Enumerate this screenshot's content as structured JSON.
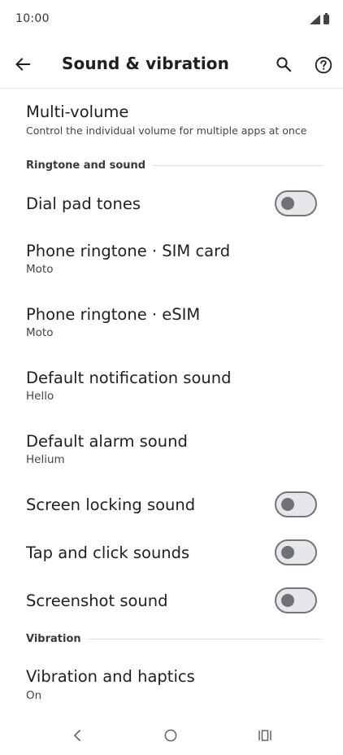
{
  "status_bar": {
    "time": "10:00",
    "icons": [
      "cell-signal-icon",
      "battery-icon"
    ]
  },
  "app_bar": {
    "title": "Sound & vibration",
    "back_icon": "arrow-back-icon",
    "search_icon": "search-icon",
    "help_icon": "help-circle-icon"
  },
  "settings": {
    "multi_volume": {
      "title": "Multi-volume",
      "summary": "Control the individual volume for multiple apps at once"
    },
    "category_ringtone": "Ringtone and sound",
    "dial_pad_tones": {
      "title": "Dial pad tones",
      "enabled": false
    },
    "ringtone_sim": {
      "title": "Phone ringtone · SIM card",
      "summary": "Moto"
    },
    "ringtone_esim": {
      "title": "Phone ringtone · eSIM",
      "summary": "Moto"
    },
    "notification_sound": {
      "title": "Default notification sound",
      "summary": "Hello"
    },
    "alarm_sound": {
      "title": "Default alarm sound",
      "summary": "Helium"
    },
    "screen_locking_sound": {
      "title": "Screen locking sound",
      "enabled": false
    },
    "tap_click_sounds": {
      "title": "Tap and click sounds",
      "enabled": false
    },
    "screenshot_sound": {
      "title": "Screenshot sound",
      "enabled": false
    },
    "category_vibration": "Vibration",
    "vibration_haptics": {
      "title": "Vibration and haptics",
      "summary": "On"
    }
  },
  "nav_bar": {
    "icons": [
      "nav-back-icon",
      "nav-home-icon",
      "nav-recents-icon"
    ]
  },
  "colors": {
    "switch_track_off": "#e6e7ea",
    "switch_border_off": "#72757a",
    "switch_knob_off": "#6e7175",
    "divider": "#dcdcdc"
  }
}
